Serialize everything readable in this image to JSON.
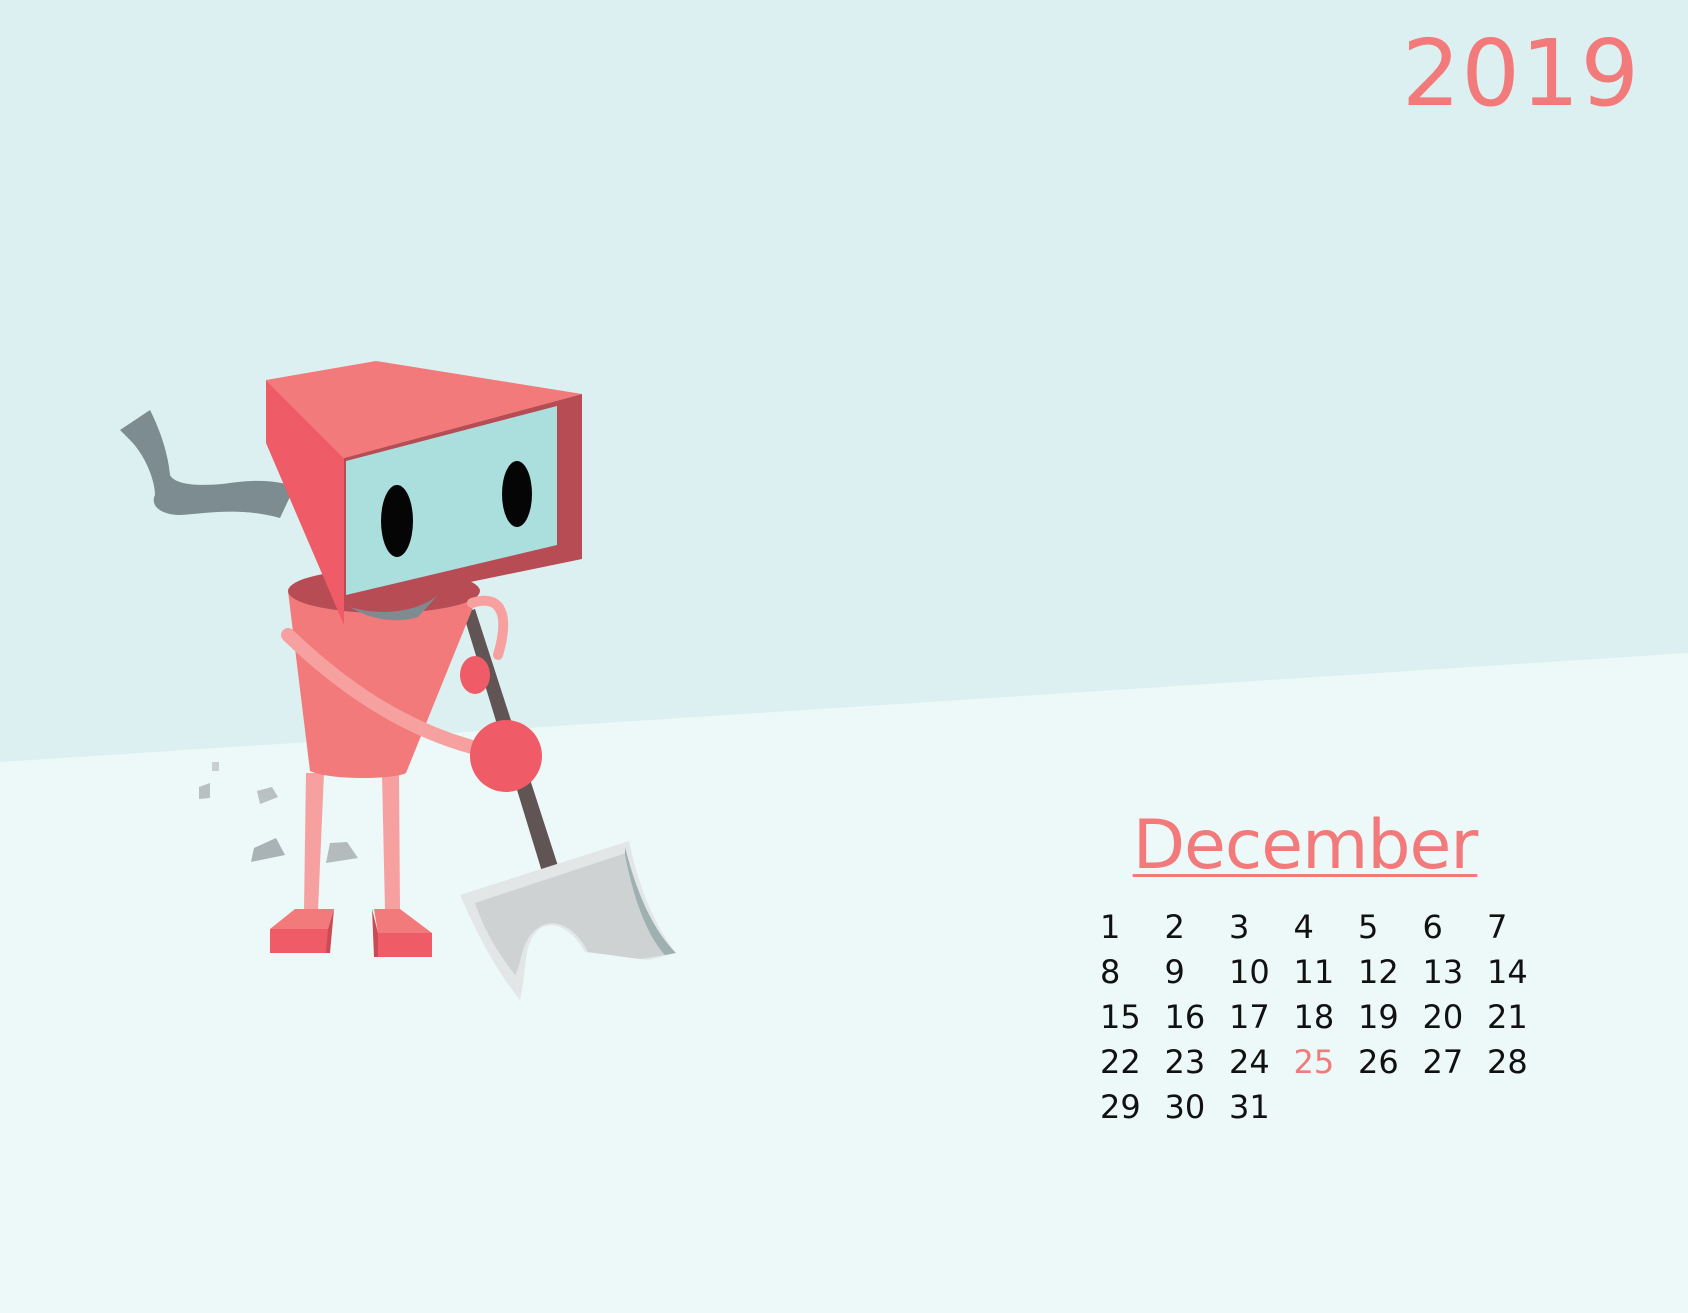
{
  "calendar": {
    "year": "2019",
    "month": "December",
    "days": [
      "1",
      "2",
      "3",
      "4",
      "5",
      "6",
      "7",
      "8",
      "9",
      "10",
      "11",
      "12",
      "13",
      "14",
      "15",
      "16",
      "17",
      "18",
      "19",
      "20",
      "21",
      "22",
      "23",
      "24",
      "25",
      "26",
      "27",
      "28",
      "29",
      "30",
      "31"
    ],
    "highlighted_day": "25"
  },
  "colors": {
    "accent": "#f37a7a",
    "sky": "#dcf0f1",
    "snow": "#edf8f8",
    "day_text": "#111111",
    "robot_body": "#f37a7a",
    "robot_dark": "#ef5b66",
    "robot_screen": "#aadfdd",
    "scarf": "#7c8c90",
    "shovel_blade": "#d2d4d4",
    "shovel_handle": "#615454"
  },
  "illustration": {
    "subject_icon": "robot-shoveling-snow-icon"
  }
}
